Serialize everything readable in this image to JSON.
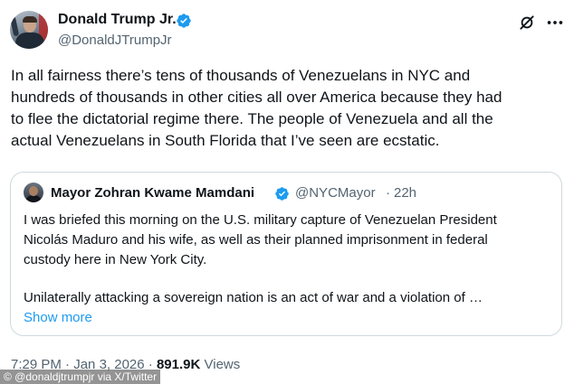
{
  "author": {
    "name": "Donald Trump Jr.",
    "handle": "@DonaldJTrumpJr"
  },
  "icons": {
    "verified": "verified-badge-icon",
    "grok": "grok-icon",
    "more": "more-options-icon"
  },
  "colors": {
    "accent": "#1d9bf0",
    "text": "#0f1419",
    "secondary": "#536471",
    "border": "#cfd9de"
  },
  "tweet": {
    "text": "In all fairness there’s tens of thousands of Venezuelans in NYC and\nhundreds of thousands in other cities all over America because they had\nto flee the dictatorial regime there. The people of Venezuela and all the\nactual Venezuelans in South Florida that I’ve seen are ecstatic."
  },
  "quote": {
    "name": "Mayor Zohran Kwame Mamdani",
    "handle": "@NYCMayor",
    "separator": "·",
    "time": "22h",
    "text": "I was briefed this morning on the U.S. military capture of Venezuelan President\nNicolás Maduro and his wife, as well as their planned imprisonment in federal\ncustody here in New York City.",
    "text2": "Unilaterally attacking a sovereign nation is an act of war and a violation of …",
    "show_more": "Show more"
  },
  "meta": {
    "time": "7:29 PM",
    "sep1": "·",
    "date": "Jan 3, 2026",
    "sep2": "·",
    "views": "891.9K",
    "views_label": "Views"
  },
  "credit": "© @donaldjtrumpjr via X/Twitter"
}
